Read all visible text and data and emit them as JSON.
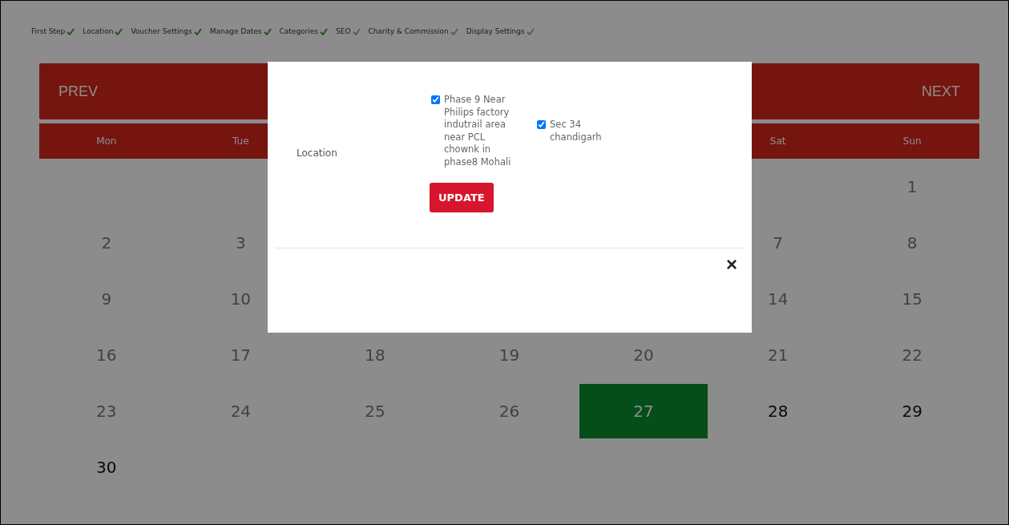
{
  "steps": [
    {
      "label": "First Step",
      "done": true
    },
    {
      "label": "Location",
      "done": true
    },
    {
      "label": "Voucher Settings",
      "done": true
    },
    {
      "label": "Manage Dates",
      "done": true
    },
    {
      "label": "Categories",
      "done": true
    },
    {
      "label": "SEO",
      "done": false
    },
    {
      "label": "Charity & Commission",
      "done": false
    },
    {
      "label": "Display Settings",
      "done": false
    }
  ],
  "calendar": {
    "prev": "PREV",
    "next": "NEXT",
    "weekdays": [
      {
        "kind": "label",
        "label": "Mon"
      },
      {
        "kind": "label",
        "label": "Tue"
      },
      {
        "kind": "blank"
      },
      {
        "kind": "blank"
      },
      {
        "kind": "blank"
      },
      {
        "kind": "label",
        "label": "Sat"
      },
      {
        "kind": "label",
        "label": "Sun"
      }
    ],
    "weeks": [
      [
        {
          "kind": "blank"
        },
        {
          "kind": "blank"
        },
        {
          "kind": "blank"
        },
        {
          "kind": "blank"
        },
        {
          "kind": "blank"
        },
        {
          "kind": "blank"
        },
        {
          "kind": "day",
          "day": "1",
          "disabled": true,
          "selected": false
        }
      ],
      [
        {
          "kind": "day",
          "day": "2",
          "disabled": true,
          "selected": false
        },
        {
          "kind": "day",
          "day": "3",
          "disabled": true,
          "selected": false
        },
        {
          "kind": "blank"
        },
        {
          "kind": "blank"
        },
        {
          "kind": "blank"
        },
        {
          "kind": "day",
          "day": "7",
          "disabled": true,
          "selected": false
        },
        {
          "kind": "day",
          "day": "8",
          "disabled": true,
          "selected": false
        }
      ],
      [
        {
          "kind": "day",
          "day": "9",
          "disabled": true,
          "selected": false
        },
        {
          "kind": "day",
          "day": "10",
          "disabled": true,
          "selected": false
        },
        {
          "kind": "blank"
        },
        {
          "kind": "blank"
        },
        {
          "kind": "blank"
        },
        {
          "kind": "day",
          "day": "14",
          "disabled": true,
          "selected": false
        },
        {
          "kind": "day",
          "day": "15",
          "disabled": true,
          "selected": false
        }
      ],
      [
        {
          "kind": "day",
          "day": "16",
          "disabled": true,
          "selected": false
        },
        {
          "kind": "day",
          "day": "17",
          "disabled": true,
          "selected": false
        },
        {
          "kind": "day",
          "day": "18",
          "disabled": true,
          "selected": false
        },
        {
          "kind": "day",
          "day": "19",
          "disabled": true,
          "selected": false
        },
        {
          "kind": "day",
          "day": "20",
          "disabled": true,
          "selected": false
        },
        {
          "kind": "day",
          "day": "21",
          "disabled": true,
          "selected": false
        },
        {
          "kind": "day",
          "day": "22",
          "disabled": true,
          "selected": false
        }
      ],
      [
        {
          "kind": "day",
          "day": "23",
          "disabled": true,
          "selected": false
        },
        {
          "kind": "day",
          "day": "24",
          "disabled": true,
          "selected": false
        },
        {
          "kind": "day",
          "day": "25",
          "disabled": true,
          "selected": false
        },
        {
          "kind": "day",
          "day": "26",
          "disabled": true,
          "selected": false
        },
        {
          "kind": "day",
          "day": "27",
          "disabled": false,
          "selected": true
        },
        {
          "kind": "day",
          "day": "28",
          "disabled": false,
          "selected": false
        },
        {
          "kind": "day",
          "day": "29",
          "disabled": false,
          "selected": false
        }
      ],
      [
        {
          "kind": "day",
          "day": "30",
          "disabled": false,
          "selected": false
        }
      ]
    ]
  },
  "modal": {
    "field_label": "Location",
    "options": [
      {
        "label": "Phase 9 Near Philips factory indutrail area near PCL chownk in phase8 Mohali",
        "checked": true
      },
      {
        "label": "Sec 34 chandigarh",
        "checked": true
      }
    ],
    "button": "UPDATE",
    "close": "×"
  }
}
